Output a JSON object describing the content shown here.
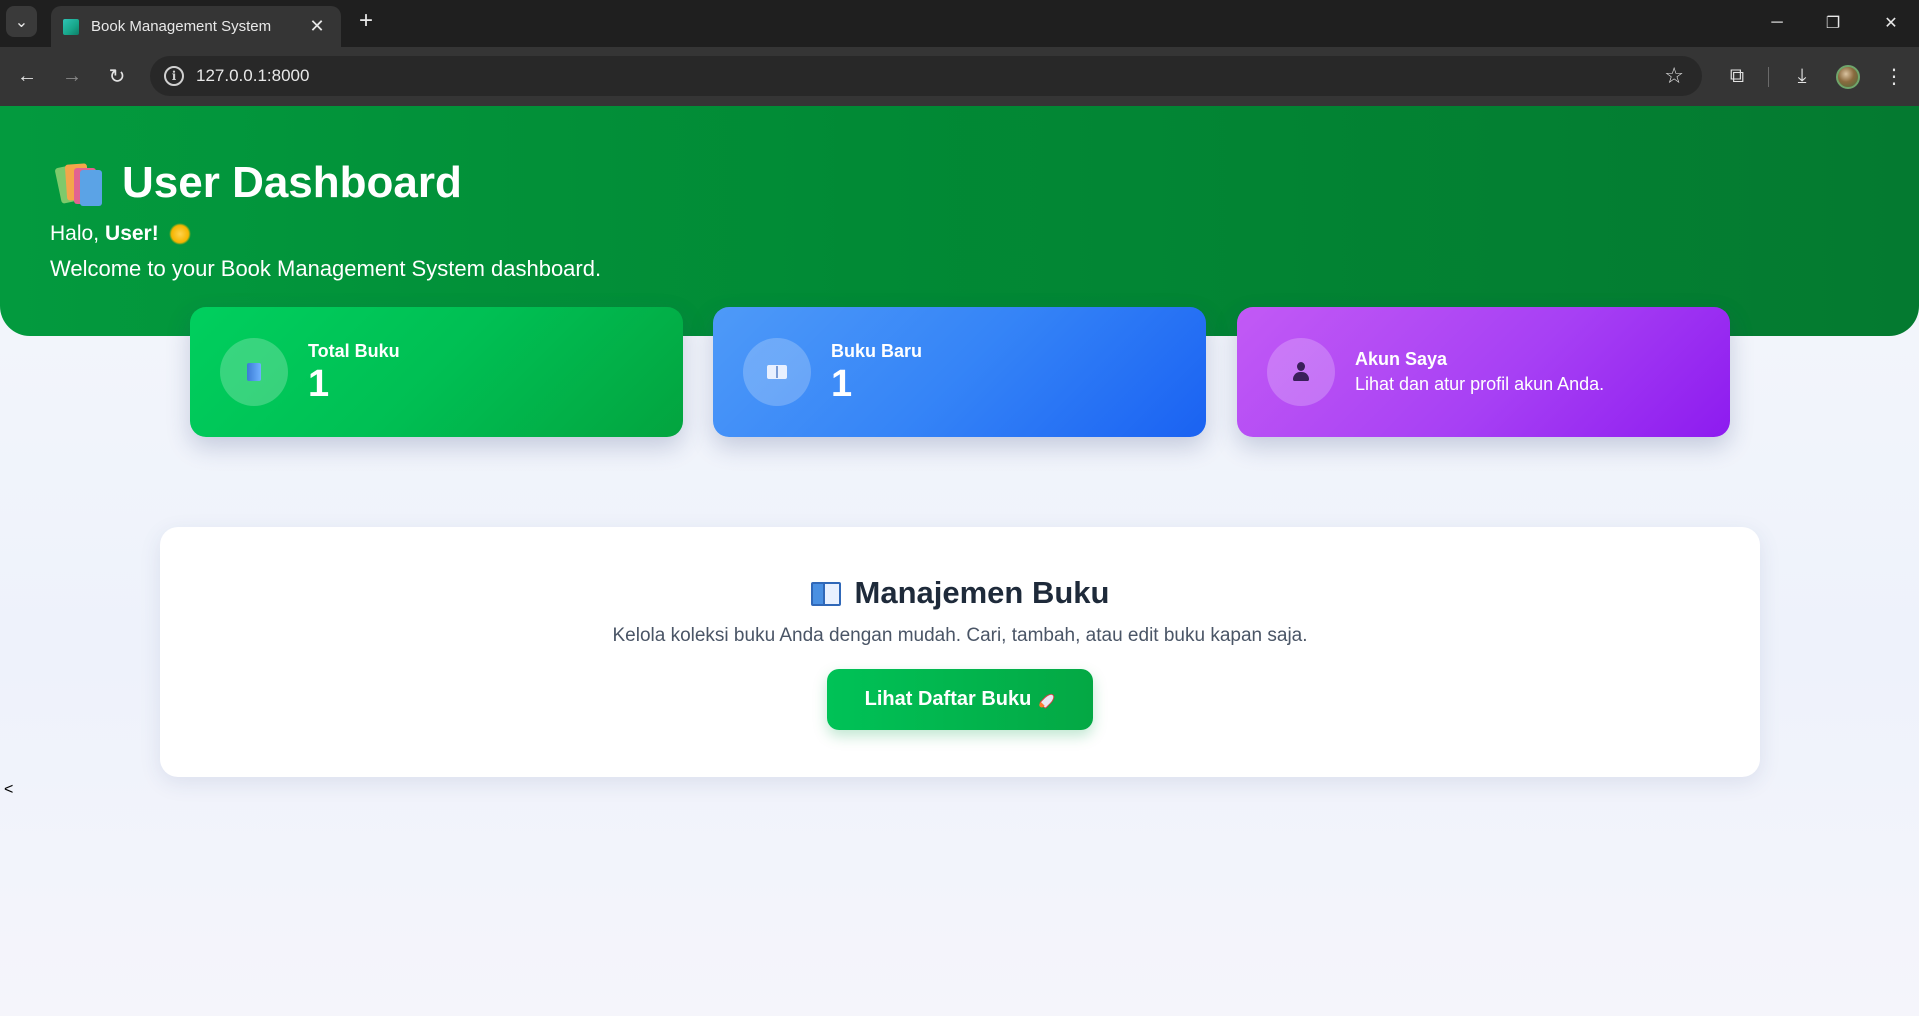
{
  "browser": {
    "tab_title": "Book Management System",
    "url": "127.0.0.1:8000",
    "close_glyph": "✕",
    "new_tab_glyph": "+",
    "back_glyph": "←",
    "forward_glyph": "→",
    "reload_glyph": "↻",
    "star_glyph": "☆",
    "minimize_glyph": "─",
    "restore_glyph": "❐",
    "window_close_glyph": "✕",
    "menu_glyph": "⋮",
    "download_glyph": "⤓",
    "extensions_glyph": "⧉",
    "tab_list_glyph": "⌄"
  },
  "hero": {
    "title": "User Dashboard",
    "greeting_prefix": "Halo,",
    "greeting_name": "User!",
    "subtitle": "Welcome to your Book Management System dashboard."
  },
  "cards": [
    {
      "label": "Total Buku",
      "value": "1",
      "icon": "blue-book-icon"
    },
    {
      "label": "Buku Baru",
      "value": "1",
      "icon": "open-book-icon"
    },
    {
      "label": "Akun Saya",
      "description": "Lihat dan atur profil akun Anda.",
      "icon": "user-icon"
    }
  ],
  "panel": {
    "title": "Manajemen Buku",
    "description": "Kelola koleksi buku Anda dengan mudah. Cari, tambah, atau edit buku kapan saja.",
    "button_label": "Lihat Daftar Buku"
  },
  "stray_text": "<",
  "colors": {
    "hero_green": "#018a35",
    "card_green": "#00bf53",
    "card_blue": "#3584f7",
    "card_purple": "#a740f4",
    "button_green": "#00c257"
  }
}
